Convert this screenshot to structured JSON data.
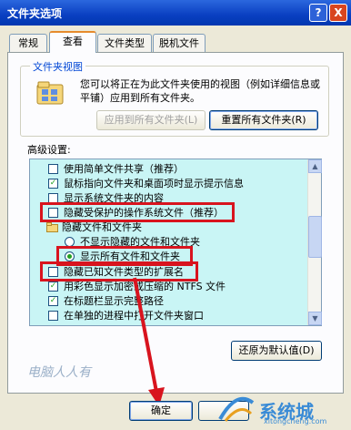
{
  "window": {
    "title": "文件夹选项",
    "help_label": "?",
    "close_label": "X"
  },
  "tabs": [
    "常规",
    "查看",
    "文件类型",
    "脱机文件"
  ],
  "folder_views": {
    "group_title": "文件夹视图",
    "description": "您可以将正在为此文件夹使用的视图（例如详细信息或平铺）应用到所有文件夹。",
    "apply_all_label": "应用到所有文件夹(L)",
    "reset_all_label": "重置所有文件夹(R)"
  },
  "advanced": {
    "label": "高级设置:",
    "items": [
      {
        "text": "使用简单文件共享（推荐）",
        "control": "checkbox",
        "checked": false
      },
      {
        "text": "鼠标指向文件夹和桌面项时显示提示信息",
        "control": "checkbox",
        "checked": true
      },
      {
        "text": "显示系统文件夹的内容",
        "control": "checkbox",
        "checked": false
      },
      {
        "text": "隐藏受保护的操作系统文件（推荐）",
        "control": "checkbox",
        "checked": false
      },
      {
        "text": "隐藏文件和文件夹",
        "control": "folder",
        "checked": false
      },
      {
        "text": "不显示隐藏的文件和文件夹",
        "control": "radio",
        "checked": false
      },
      {
        "text": "显示所有文件和文件夹",
        "control": "radio",
        "checked": true
      },
      {
        "text": "隐藏已知文件类型的扩展名",
        "control": "checkbox",
        "checked": false
      },
      {
        "text": "用彩色显示加密或压缩的 NTFS 文件",
        "control": "checkbox",
        "checked": true
      },
      {
        "text": "在标题栏显示完整路径",
        "control": "checkbox",
        "checked": true
      },
      {
        "text": "在单独的进程中打开文件夹窗口",
        "control": "checkbox",
        "checked": false
      }
    ]
  },
  "restore_defaults_label": "还原为默认值(D)",
  "ok_label": "确定",
  "watermark": "电脑人人有",
  "logo": {
    "text": "系统城",
    "url": "xitongcheng.com"
  },
  "colors": {
    "highlight": "#d8141e",
    "tree_bg": "#c9f5f5",
    "titlebar": "#0a3fc1"
  }
}
